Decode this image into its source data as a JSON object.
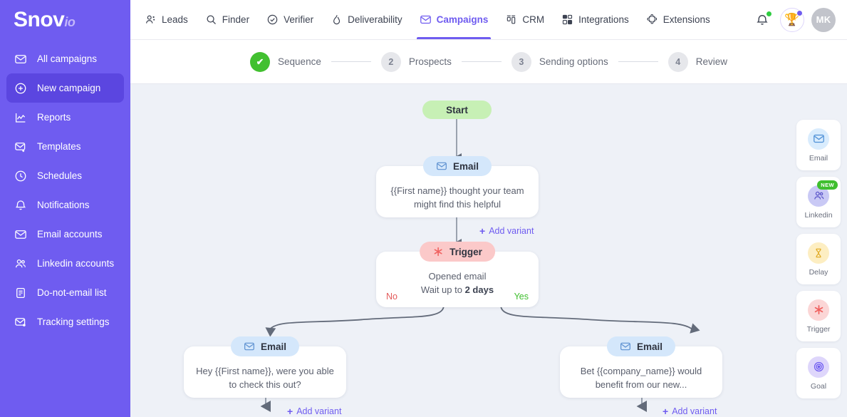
{
  "brand": {
    "name": "Snov",
    "suffix": "io",
    "color": "#6f5cf0"
  },
  "topnav": {
    "items": [
      {
        "label": "Leads",
        "icon": "people-icon",
        "active": false
      },
      {
        "label": "Finder",
        "icon": "search-icon",
        "active": false
      },
      {
        "label": "Verifier",
        "icon": "check-circle-icon",
        "active": false
      },
      {
        "label": "Deliverability",
        "icon": "flame-icon",
        "active": false
      },
      {
        "label": "Campaigns",
        "icon": "envelope-icon",
        "active": true
      },
      {
        "label": "CRM",
        "icon": "crm-icon",
        "active": false
      },
      {
        "label": "Integrations",
        "icon": "grid-icon",
        "active": false
      },
      {
        "label": "Extensions",
        "icon": "puzzle-icon",
        "active": false
      }
    ],
    "notifications_icon": "bell-icon",
    "notifications_badge_color": "#2ecc40",
    "rewards_icon": "trophy-icon",
    "rewards_badge_color": "#6f5cf0",
    "avatar_initials": "MK"
  },
  "sidebar": {
    "items": [
      {
        "label": "All campaigns",
        "icon": "envelope-icon",
        "active": false
      },
      {
        "label": "New campaign",
        "icon": "plus-circle-icon",
        "active": true
      },
      {
        "label": "Reports",
        "icon": "chart-icon",
        "active": false
      },
      {
        "label": "Templates",
        "icon": "envelope-plus-icon",
        "active": false
      },
      {
        "label": "Schedules",
        "icon": "clock-icon",
        "active": false
      },
      {
        "label": "Notifications",
        "icon": "bell-icon",
        "active": false
      },
      {
        "label": "Email accounts",
        "icon": "envelope-icon",
        "active": false
      },
      {
        "label": "Linkedin accounts",
        "icon": "people-icon",
        "active": false
      },
      {
        "label": "Do-not-email list",
        "icon": "document-icon",
        "active": false
      },
      {
        "label": "Tracking settings",
        "icon": "envelope-dot-icon",
        "active": false
      }
    ]
  },
  "stepper": {
    "steps": [
      {
        "number": "1",
        "label": "Sequence",
        "state": "done"
      },
      {
        "number": "2",
        "label": "Prospects",
        "state": "todo"
      },
      {
        "number": "3",
        "label": "Sending options",
        "state": "todo"
      },
      {
        "number": "4",
        "label": "Review",
        "state": "todo"
      }
    ],
    "done_color": "#42c030",
    "check_glyph": "✔"
  },
  "flow": {
    "start": {
      "label": "Start"
    },
    "email_1": {
      "pill_label": "Email",
      "icon": "envelope-icon",
      "body": "{{First name}} thought your team might find this helpful",
      "add_variant_label": "Add variant"
    },
    "trigger": {
      "pill_label": "Trigger",
      "icon": "asterisk-icon",
      "condition": "Opened email",
      "wait_prefix": "Wait up to ",
      "wait_value": "2 days",
      "no_label": "No",
      "yes_label": "Yes",
      "no_color": "#e35b5b",
      "yes_color": "#3fbf2e"
    },
    "email_no": {
      "pill_label": "Email",
      "icon": "envelope-icon",
      "body": "Hey {{First name}}, were you able to check this out?",
      "add_variant_label": "Add variant"
    },
    "email_yes": {
      "pill_label": "Email",
      "icon": "envelope-icon",
      "body": "Bet {{company_name}} would benefit from our new...",
      "add_variant_label": "Add variant"
    }
  },
  "toolbox": {
    "items": [
      {
        "label": "Email",
        "icon": "envelope-icon",
        "badge": "",
        "bg": "#d9ecfd"
      },
      {
        "label": "Linkedin",
        "icon": "people-icon",
        "badge": "NEW",
        "bg": "#c9c9f5"
      },
      {
        "label": "Delay",
        "icon": "hourglass-icon",
        "badge": "",
        "bg": "#fdeec2"
      },
      {
        "label": "Trigger",
        "icon": "asterisk-icon",
        "badge": "",
        "bg": "#fbd6d6"
      },
      {
        "label": "Goal",
        "icon": "target-icon",
        "badge": "",
        "bg": "#ded6fb"
      }
    ]
  }
}
